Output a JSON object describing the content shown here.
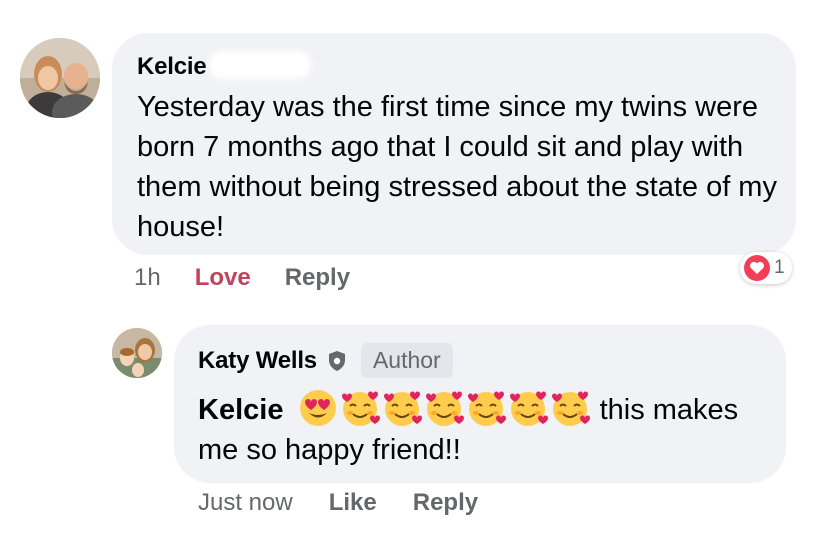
{
  "comments": [
    {
      "author": "Kelcie",
      "text": "Yesterday was the first time since my twins were born 7 months ago that I could sit and play with them without being stressed about the state of my house!",
      "time": "1h",
      "reaction_label": "Love",
      "reply_label": "Reply",
      "reaction_count": "1",
      "reaction_icon": "heart-icon",
      "reaction_color": "#f33e58",
      "reaction_label_color": "#c2435c"
    },
    {
      "author": "Katy Wells",
      "author_badge": "Author",
      "mention": "Kelcie",
      "text_after_emoji_line1": "this makes",
      "text_line2": "me so happy friend!!",
      "emojis": [
        "smiling-face-with-heart-eyes",
        "smiling-face-with-hearts",
        "smiling-face-with-hearts",
        "smiling-face-with-hearts",
        "smiling-face-with-hearts",
        "smiling-face-with-hearts",
        "smiling-face-with-hearts"
      ],
      "time": "Just now",
      "reaction_label": "Like",
      "reply_label": "Reply"
    }
  ],
  "colors": {
    "bubble": "#f0f2f5",
    "meta_text": "#65676b"
  }
}
